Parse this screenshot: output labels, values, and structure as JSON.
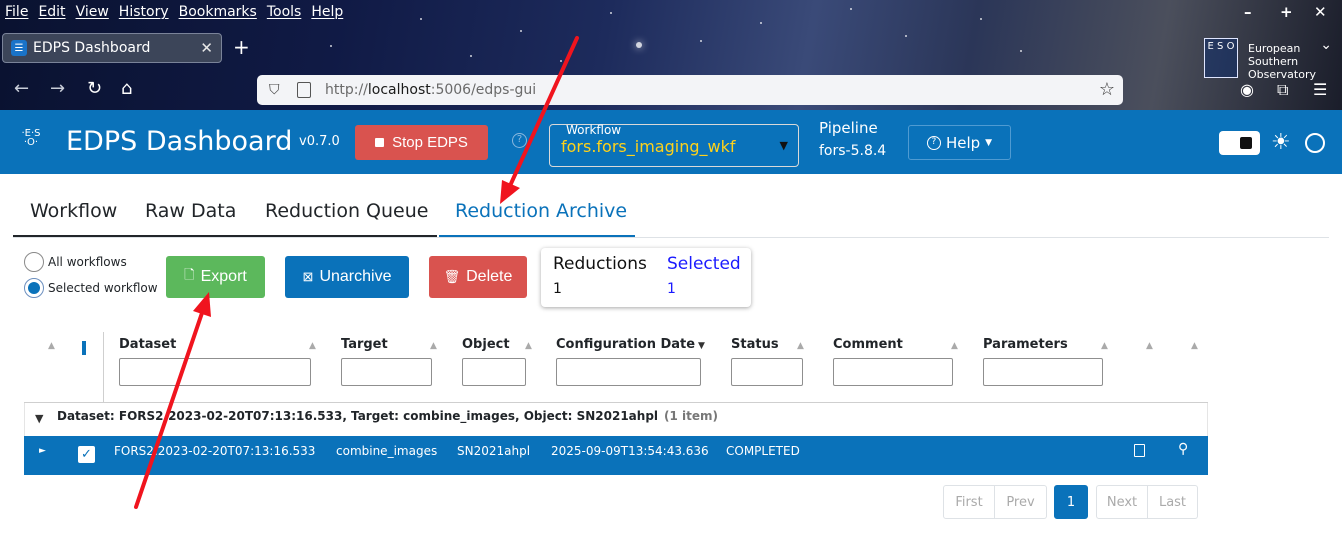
{
  "browser": {
    "menu": [
      "File",
      "Edit",
      "View",
      "History",
      "Bookmarks",
      "Tools",
      "Help"
    ],
    "tab_title": "EDPS Dashboard",
    "url_prefix": "http://",
    "url_host": "localhost",
    "url_rest": ":5006/edps-gui",
    "eso_logo_text": "E S O",
    "eso_text_lines": [
      "European",
      "Southern",
      "Observatory"
    ]
  },
  "header": {
    "title": "EDPS Dashboard",
    "version": "v0.7.0",
    "stop_label": "Stop EDPS",
    "workflow_label": "Workflow",
    "workflow_value": "fors.fors_imaging_wkf",
    "pipeline_label": "Pipeline",
    "pipeline_value": "fors-5.8.4",
    "help_label": "Help"
  },
  "tabs": [
    {
      "label": "Workflow"
    },
    {
      "label": "Raw Data"
    },
    {
      "label": "Reduction Queue"
    },
    {
      "label": "Reduction Archive",
      "active": true
    }
  ],
  "controls": {
    "radio_all": "All workflows",
    "radio_selected": "Selected workflow",
    "export_label": "Export",
    "unarchive_label": "Unarchive",
    "delete_label": "Delete"
  },
  "summary": {
    "reductions_label": "Reductions",
    "reductions_value": "1",
    "selected_label": "Selected",
    "selected_value": "1"
  },
  "grid": {
    "columns": [
      "Dataset",
      "Target",
      "Object",
      "Configuration Date",
      "Status",
      "Comment",
      "Parameters"
    ],
    "group_text": "Dataset: FORS2.2023-02-20T07:13:16.533, Target: combine_images, Object: SN2021ahpl",
    "group_count": "(1 item)",
    "row": {
      "dataset": "FORS2.2023-02-20T07:13:16.533",
      "target": "combine_images",
      "object": "SN2021ahpl",
      "config_date": "2025-09-09T13:54:43.636",
      "status": "COMPLETED"
    }
  },
  "pager": {
    "first": "First",
    "prev": "Prev",
    "current": "1",
    "next": "Next",
    "last": "Last"
  },
  "colors": {
    "brand_blue": "#0a72ba",
    "export_green": "#5cb85c",
    "danger_red": "#d9534f",
    "workflow_yellow": "#ffd21a",
    "annotation_red": "#f0141e"
  }
}
